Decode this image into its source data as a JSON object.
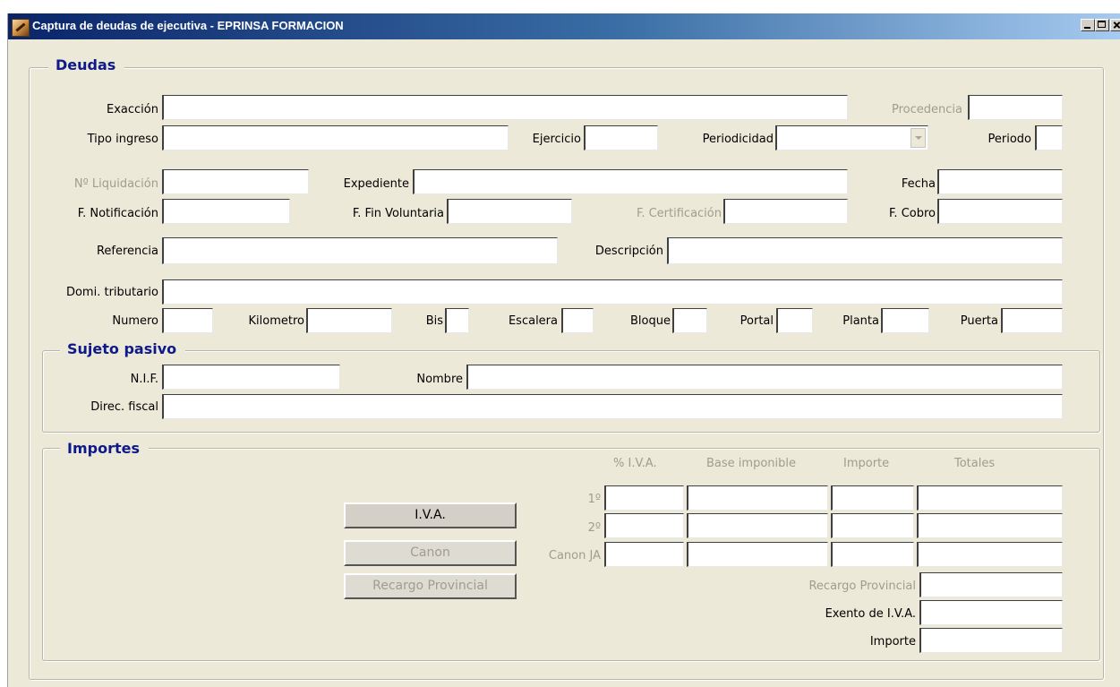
{
  "window": {
    "title": "Captura de deudas de ejecutiva - EPRINSA FORMACION",
    "icon": "app-icon",
    "controls": [
      "minimize-icon",
      "maximize-icon",
      "close-icon"
    ]
  },
  "deudas": {
    "legend": "Deudas",
    "exaccion_label": "Exacción",
    "procedencia_label": "Procedencia",
    "tipo_ingreso_label": "Tipo ingreso",
    "ejercicio_label": "Ejercicio",
    "periodicidad_label": "Periodicidad",
    "periodo_label": "Periodo",
    "n_liquidacion_label": "Nº Liquidación",
    "expediente_label": "Expediente",
    "fecha_label": "Fecha",
    "f_notificacion_label": "F. Notificación",
    "f_fin_voluntaria_label": "F. Fin Voluntaria",
    "f_certificacion_label": "F. Certificación",
    "f_cobro_label": "F. Cobro",
    "referencia_label": "Referencia",
    "descripcion_label": "Descripción",
    "domi_tributario_label": "Domi. tributario",
    "numero_label": "Numero",
    "kilometro_label": "Kilometro",
    "bis_label": "Bis",
    "escalera_label": "Escalera",
    "bloque_label": "Bloque",
    "portal_label": "Portal",
    "planta_label": "Planta",
    "puerta_label": "Puerta"
  },
  "sujeto": {
    "legend": "Sujeto pasivo",
    "nif_label": "N.I.F.",
    "nombre_label": "Nombre",
    "direc_fiscal_label": "Direc. fiscal"
  },
  "importes": {
    "legend": "Importes",
    "headers": [
      "% I.V.A.",
      "Base imponible",
      "Importe",
      "Totales"
    ],
    "rows": [
      "1º",
      "2º",
      "Canon JA"
    ],
    "buttons": {
      "iva": "I.V.A.",
      "canon": "Canon",
      "recargo": "Recargo Provincial"
    },
    "recargo_label": "Recargo Provincial",
    "exento_label": "Exento de I.V.A.",
    "importe_label": "Importe"
  }
}
